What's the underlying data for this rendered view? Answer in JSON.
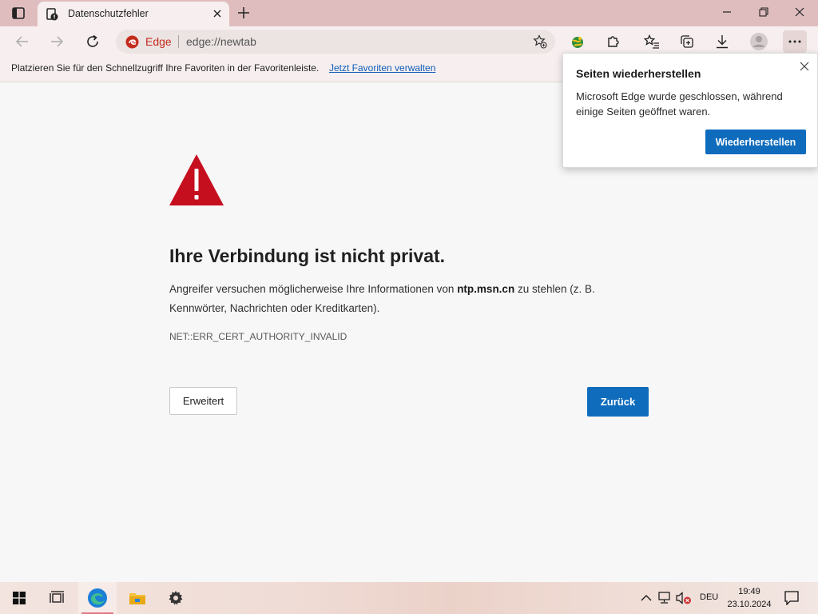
{
  "browser": {
    "tab": {
      "title": "Datenschutzfehler"
    },
    "address": {
      "badge_label": "Edge",
      "url": "edge://newtab"
    },
    "favorites_bar": {
      "hint": "Platzieren Sie für den Schnellzugriff Ihre Favoriten in der Favoritenleiste.",
      "manage_link": "Jetzt Favoriten verwalten"
    }
  },
  "error_page": {
    "title": "Ihre Verbindung ist nicht privat.",
    "description_before": "Angreifer versuchen möglicherweise Ihre Informationen von ",
    "host": "ntp.msn.cn",
    "description_after": " zu stehlen (z. B. Kennwörter, Nachrichten oder Kreditkarten).",
    "error_code": "NET::ERR_CERT_AUTHORITY_INVALID",
    "advanced_button": "Erweitert",
    "back_button": "Zurück"
  },
  "restore_popup": {
    "title": "Seiten wiederherstellen",
    "message": "Microsoft Edge wurde geschlossen, während einige Seiten geöffnet waren.",
    "button": "Wiederherstellen"
  },
  "taskbar": {
    "language": "DEU",
    "time": "19:49",
    "date": "23.10.2024"
  },
  "colors": {
    "accent": "#0f6cbd",
    "warning": "#c50f1f",
    "titlebar": "#dfbdbf"
  }
}
